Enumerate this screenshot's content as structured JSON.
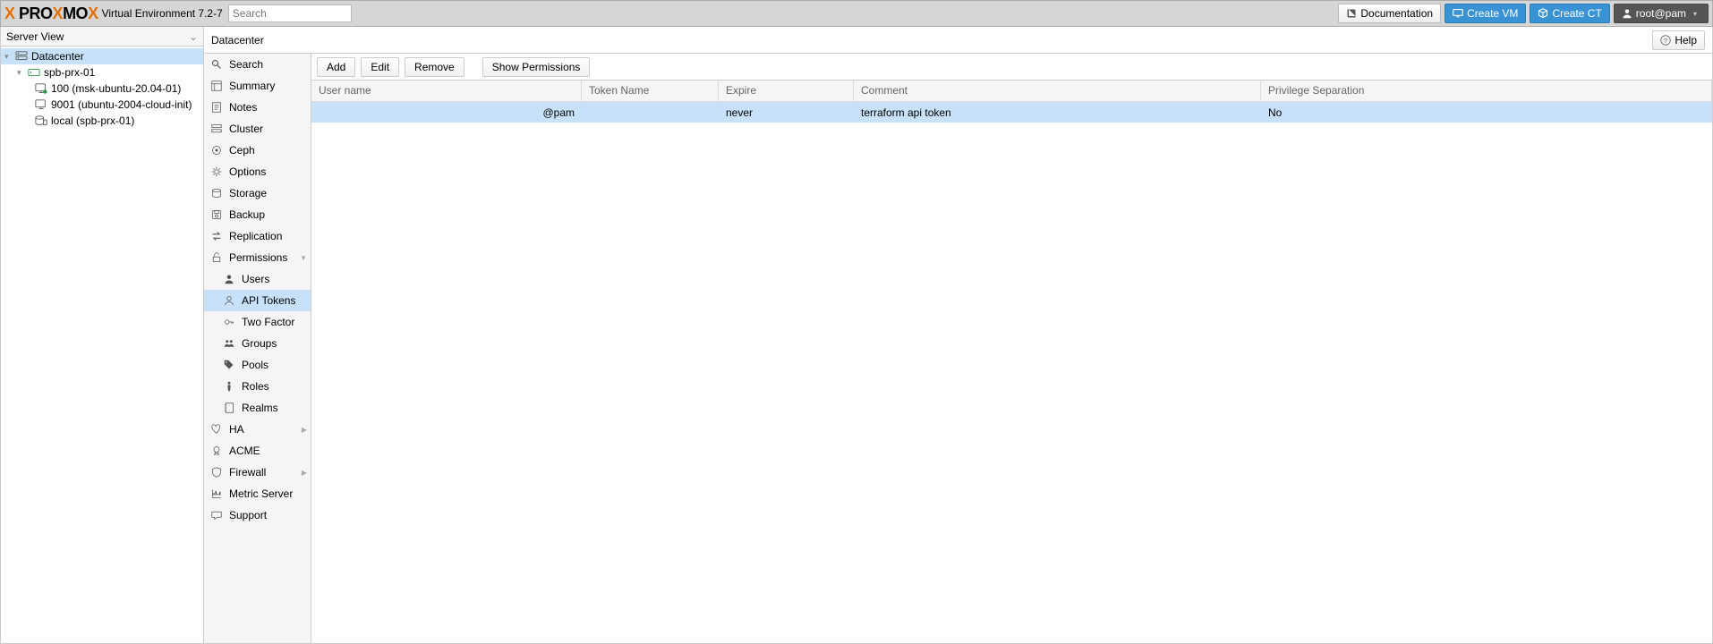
{
  "header": {
    "product": "PROXMOX",
    "ve_label": "Virtual Environment 7.2-7",
    "search_placeholder": "Search",
    "documentation_label": "Documentation",
    "create_vm_label": "Create VM",
    "create_ct_label": "Create CT",
    "user_label": "root@pam"
  },
  "tree": {
    "view_label": "Server View",
    "items": [
      {
        "label": "Datacenter",
        "icon": "server",
        "level": 0,
        "expandable": true,
        "selected": true
      },
      {
        "label": "spb-prx-01",
        "icon": "node",
        "level": 1,
        "expandable": true
      },
      {
        "label": "100 (msk-ubuntu-20.04-01)",
        "icon": "vm",
        "level": 2
      },
      {
        "label": "9001 (ubuntu-2004-cloud-init)",
        "icon": "vm",
        "level": 2
      },
      {
        "label": "local (spb-prx-01)",
        "icon": "storage",
        "level": 2
      }
    ]
  },
  "content": {
    "title": "Datacenter",
    "help_label": "Help"
  },
  "sidebar": {
    "items": [
      {
        "label": "Search",
        "icon": "search"
      },
      {
        "label": "Summary",
        "icon": "summary"
      },
      {
        "label": "Notes",
        "icon": "notes"
      },
      {
        "label": "Cluster",
        "icon": "cluster"
      },
      {
        "label": "Ceph",
        "icon": "ceph"
      },
      {
        "label": "Options",
        "icon": "gear"
      },
      {
        "label": "Storage",
        "icon": "storage"
      },
      {
        "label": "Backup",
        "icon": "backup"
      },
      {
        "label": "Replication",
        "icon": "replication"
      },
      {
        "label": "Permissions",
        "icon": "lock",
        "arrow": "down"
      },
      {
        "label": "Users",
        "icon": "user",
        "sub": true
      },
      {
        "label": "API Tokens",
        "icon": "user-o",
        "sub": true,
        "active": true
      },
      {
        "label": "Two Factor",
        "icon": "key",
        "sub": true
      },
      {
        "label": "Groups",
        "icon": "users",
        "sub": true
      },
      {
        "label": "Pools",
        "icon": "tags",
        "sub": true
      },
      {
        "label": "Roles",
        "icon": "male",
        "sub": true
      },
      {
        "label": "Realms",
        "icon": "address-book",
        "sub": true
      },
      {
        "label": "HA",
        "icon": "heartbeat",
        "arrow": "right"
      },
      {
        "label": "ACME",
        "icon": "cert"
      },
      {
        "label": "Firewall",
        "icon": "shield",
        "arrow": "right"
      },
      {
        "label": "Metric Server",
        "icon": "chart"
      },
      {
        "label": "Support",
        "icon": "support"
      }
    ]
  },
  "toolbar": {
    "add_label": "Add",
    "edit_label": "Edit",
    "remove_label": "Remove",
    "show_permissions_label": "Show Permissions"
  },
  "grid": {
    "columns": {
      "user": "User name",
      "token": "Token Name",
      "expire": "Expire",
      "comment": "Comment",
      "priv": "Privilege Separation"
    },
    "rows": [
      {
        "user": "@pam",
        "token": "",
        "expire": "never",
        "comment": "terraform api token",
        "priv": "No"
      }
    ]
  }
}
